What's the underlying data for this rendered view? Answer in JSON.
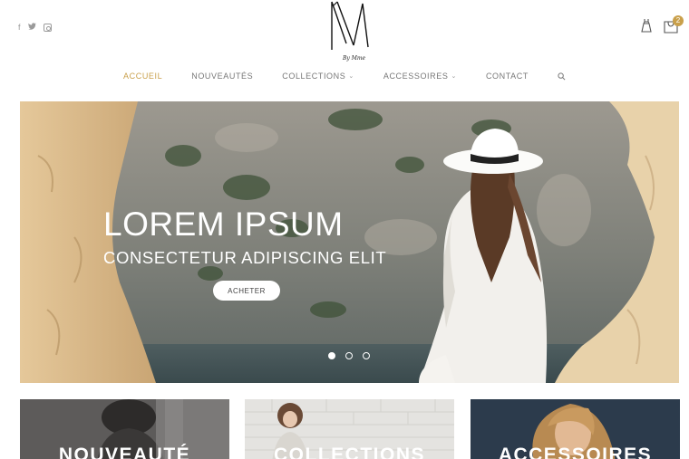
{
  "header": {
    "social_icons": [
      "facebook-icon",
      "twitter-icon",
      "instagram-icon"
    ],
    "logo_caption": "By Mme",
    "cart_count": "2"
  },
  "nav": {
    "items": [
      {
        "label": "ACCUEIL",
        "active": true,
        "has_dropdown": false
      },
      {
        "label": "NOUVEAUTÉS",
        "active": false,
        "has_dropdown": false
      },
      {
        "label": "COLLECTIONS",
        "active": false,
        "has_dropdown": true
      },
      {
        "label": "ACCESSOIRES",
        "active": false,
        "has_dropdown": true
      },
      {
        "label": "CONTACT",
        "active": false,
        "has_dropdown": false
      }
    ],
    "search_icon": "search-icon"
  },
  "hero": {
    "title": "LOREM IPSUM",
    "subtitle": "CONSECTETUR ADIPISCING ELIT",
    "button_label": "ACHETER",
    "active_slide": 1,
    "slide_count": 3
  },
  "categories": [
    {
      "label": "NOUVEAUTÉ"
    },
    {
      "label": "COLLECTIONS"
    },
    {
      "label": "ACCESSOIRES"
    }
  ],
  "colors": {
    "accent": "#c9a04b",
    "text": "#777777"
  }
}
